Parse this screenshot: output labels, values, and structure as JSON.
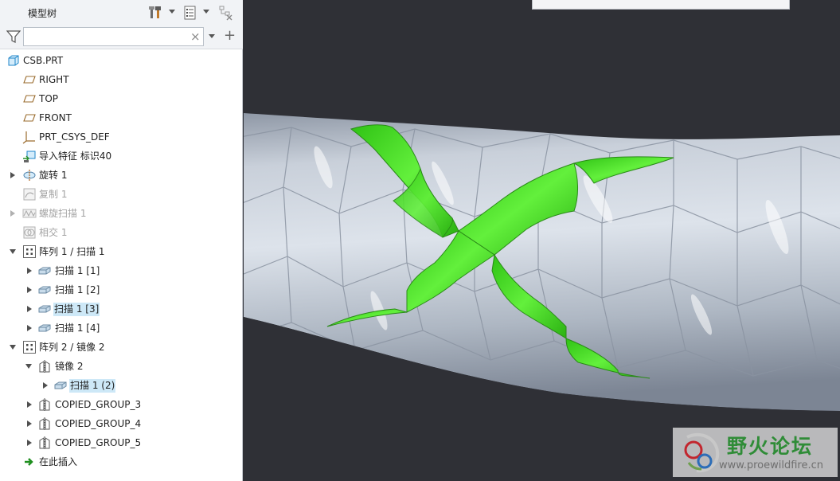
{
  "panel": {
    "title": "模型树",
    "header_icons": [
      "tools-icon",
      "list-settings-icon",
      "tree-filter-icon"
    ],
    "search": {
      "value": "",
      "placeholder": "",
      "clear_glyph": "×"
    },
    "add_glyph": "+"
  },
  "tree": {
    "items": [
      {
        "label": "CSB.PRT",
        "icon": "part-icon",
        "toggle": "none",
        "state": "normal"
      },
      {
        "label": "RIGHT",
        "icon": "datum-plane-icon",
        "toggle": "none",
        "state": "normal"
      },
      {
        "label": "TOP",
        "icon": "datum-plane-icon",
        "toggle": "none",
        "state": "normal"
      },
      {
        "label": "FRONT",
        "icon": "datum-plane-icon",
        "toggle": "none",
        "state": "normal"
      },
      {
        "label": "PRT_CSYS_DEF",
        "icon": "csys-icon",
        "toggle": "none",
        "state": "normal"
      },
      {
        "label": "导入特征 标识40",
        "icon": "import-feature-icon",
        "toggle": "none",
        "state": "normal"
      },
      {
        "label": "旋转 1",
        "icon": "revolve-icon",
        "toggle": "closed",
        "state": "normal"
      },
      {
        "label": "复制 1",
        "icon": "copy-icon",
        "toggle": "none",
        "state": "suppressed"
      },
      {
        "label": "螺旋扫描 1",
        "icon": "helical-sweep-icon",
        "toggle": "closed",
        "state": "suppressed"
      },
      {
        "label": "相交 1",
        "icon": "intersect-icon",
        "toggle": "none",
        "state": "suppressed"
      },
      {
        "label": "阵列 1 / 扫描 1",
        "icon": "pattern-icon",
        "toggle": "open",
        "state": "normal"
      },
      {
        "label": "扫描 1 [1]",
        "icon": "sweep-icon",
        "toggle": "closed",
        "state": "normal"
      },
      {
        "label": "扫描 1 [2]",
        "icon": "sweep-icon",
        "toggle": "closed",
        "state": "normal"
      },
      {
        "label": "扫描 1 [3]",
        "icon": "sweep-icon",
        "toggle": "closed",
        "state": "selected"
      },
      {
        "label": "扫描 1 [4]",
        "icon": "sweep-icon",
        "toggle": "closed",
        "state": "normal"
      },
      {
        "label": "阵列 2 / 镜像 2",
        "icon": "pattern-icon",
        "toggle": "open",
        "state": "normal"
      },
      {
        "label": "镜像 2",
        "icon": "mirror-icon",
        "toggle": "open",
        "state": "normal"
      },
      {
        "label": "扫描 1 (2)",
        "icon": "sweep-icon",
        "toggle": "closed",
        "state": "selected"
      },
      {
        "label": "COPIED_GROUP_3",
        "icon": "mirror-icon",
        "toggle": "closed",
        "state": "normal"
      },
      {
        "label": "COPIED_GROUP_4",
        "icon": "mirror-icon",
        "toggle": "closed",
        "state": "normal"
      },
      {
        "label": "COPIED_GROUP_5",
        "icon": "mirror-icon",
        "toggle": "closed",
        "state": "normal"
      },
      {
        "label": "在此插入",
        "icon": "insert-here-arrow-icon",
        "toggle": "none",
        "state": "normal"
      }
    ]
  },
  "viewport": {
    "model": "diamond-knurled-cylinder",
    "highlight_color": "#3ed61f",
    "surface_color": "#bcc4cf",
    "background_color": "#2f3036"
  },
  "watermark": {
    "title": "野火论坛",
    "url": "www.proewildfire.cn"
  }
}
